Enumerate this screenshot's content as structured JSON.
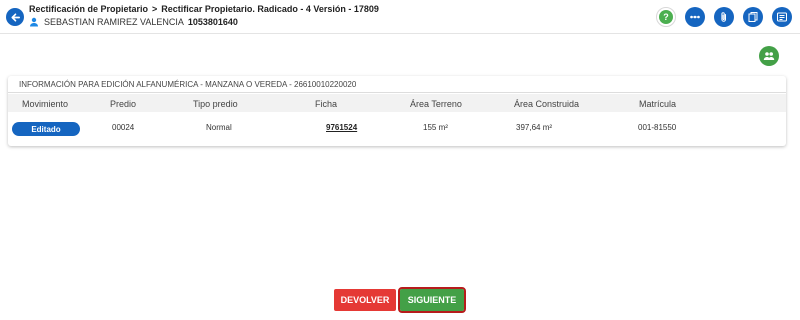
{
  "header": {
    "crumb_1": "Rectificación de Propietario",
    "crumb_sep": ">",
    "crumb_2": "Rectificar Propietario. Radicado - 4 Versión - 17809",
    "user_name": "SEBASTIAN RAMIREZ VALENCIA",
    "user_id": "1053801640",
    "icons": [
      "help-icon",
      "more-horizontal-icon",
      "attachment-icon",
      "documents-icon",
      "notes-icon"
    ]
  },
  "card": {
    "title": "INFORMACIÓN PARA EDICIÓN ALFANUMÉRICA - MANZANA O VEREDA - 26610010220020",
    "columns": [
      "Movimiento",
      "Predio",
      "Tipo predio",
      "Ficha",
      "Área Terreno",
      "Área Construida",
      "Matrícula"
    ],
    "rows": [
      {
        "movimiento": "Editado",
        "predio": "00024",
        "tipo_predio": "Normal",
        "ficha": "9761524",
        "area_terreno": "155 m²",
        "area_construida": "397,64 m²",
        "matricula": "001-81550"
      }
    ]
  },
  "actions": {
    "devolver": "DEVOLVER",
    "siguiente": "SIGUIENTE"
  },
  "colors": {
    "primary": "#1565c0",
    "success": "#43a047",
    "danger": "#e53935",
    "highlight_outline": "#b71c1c"
  }
}
